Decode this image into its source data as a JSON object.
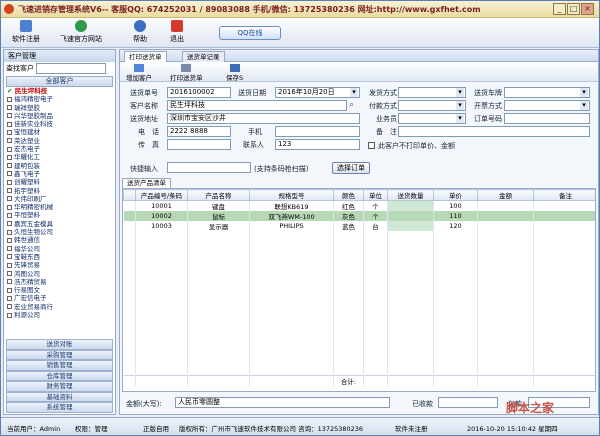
{
  "window": {
    "title": "飞速进销存管理系统V6-- 客服QQ: 674252031 / 89083088 手机/微信: 13725380236 网址:http://www.gxfhet.com",
    "controls": [
      "_",
      "□",
      "×"
    ]
  },
  "toolbar": {
    "items": [
      {
        "label": "软件注册",
        "icon": "register-icon"
      },
      {
        "label": "飞速官方网站",
        "icon": "website-icon"
      },
      {
        "label": "帮助",
        "icon": "help-icon"
      },
      {
        "label": "退出",
        "icon": "exit-icon"
      }
    ],
    "qq_label": "QQ在线"
  },
  "sidebar": {
    "header": "客户管理",
    "search_label": "查找客户",
    "group_label": "全部客户",
    "customers": [
      "民生坪科技",
      "福鸿精密电子",
      "瑞祥塑胶",
      "兴华塑胶制品",
      "佳新实业科技",
      "宝恒建材",
      "荣达塑业",
      "宏杰电子",
      "华耀化工",
      "建明包装",
      "鑫飞电子",
      "创耀塑料",
      "拓宇塑料",
      "大伟印刷厂",
      "华明精密机械",
      "平恒塑料",
      "嘉宾五金模具",
      "久恒生物公司",
      "韩世通信",
      "福华公司",
      "宝鞋东西",
      "先锋贸易",
      "鸿图公司",
      "浩杰精贸易",
      "行易图文",
      "广宏信电子",
      "宏业贸易商行",
      "利源公司"
    ],
    "modules": [
      "送货对账",
      "采购管理",
      "销售管理",
      "仓库管理",
      "财务管理",
      "基础资料",
      "系统管理"
    ]
  },
  "main": {
    "tabs": [
      "打印送货单",
      "送货单记录"
    ],
    "subbar": [
      "增加客户",
      "打印送货单",
      "保存S"
    ],
    "form": {
      "order_no_label": "送货单号",
      "order_no": "2016100002",
      "date_label": "送货日期",
      "date": "2016年10月20日",
      "customer_label": "客户名称",
      "customer": "民生坪科技",
      "address_label": "送货地址",
      "address": "深圳市宝安区沙井",
      "phone_label": "电　话",
      "phone": "2222 8888",
      "mobile_label": "手机",
      "mobile": "",
      "fax_label": "传　真",
      "fax": "",
      "contact_label": "联系人",
      "contact": "123",
      "ship_method_label": "发货方式",
      "pay_method_label": "付款方式",
      "salesman_label": "业务员",
      "remark_label": "备　注",
      "car_label": "送货车牌",
      "invoice_label": "开票方式",
      "order_label": "订单号码",
      "no_price_label": "此客户不打印单价、金额",
      "quick_label": "快捷输入",
      "quick_hint": "(支持条码枪扫描)",
      "choose_button": "选择订单"
    },
    "grid": {
      "tab_label": "送货产品清单",
      "columns": [
        "产品编号/条码",
        "产品名称",
        "规格型号",
        "颜色",
        "单位",
        "送货数量",
        "单价",
        "金额",
        "备注"
      ],
      "rows": [
        [
          "10001",
          "键盘",
          "联想KB619",
          "红色",
          "个",
          "",
          "100",
          "",
          ""
        ],
        [
          "10002",
          "鼠标",
          "双飞燕WM-100",
          "灰色",
          "个",
          "",
          "110",
          "",
          ""
        ],
        [
          "10003",
          "显示器",
          "PHILIPS",
          "蓝色",
          "台",
          "",
          "120",
          "",
          ""
        ]
      ],
      "total_label": "合计:"
    },
    "footer": {
      "amount_label": "金额(大写):",
      "amount_value": "人民币零圆整",
      "received_label": "已收款",
      "arrears_label": "欠款"
    }
  },
  "status": {
    "user": "当前用户：Admin",
    "rights": "权限：管理",
    "version": "正版自用",
    "copyright": "版权所有：广州市飞速软件技术有限公司 咨询：13725380236",
    "reg": "软件未注册",
    "time": "2016-10-20 15:10:42 星期四"
  },
  "watermark": "脚本之家"
}
